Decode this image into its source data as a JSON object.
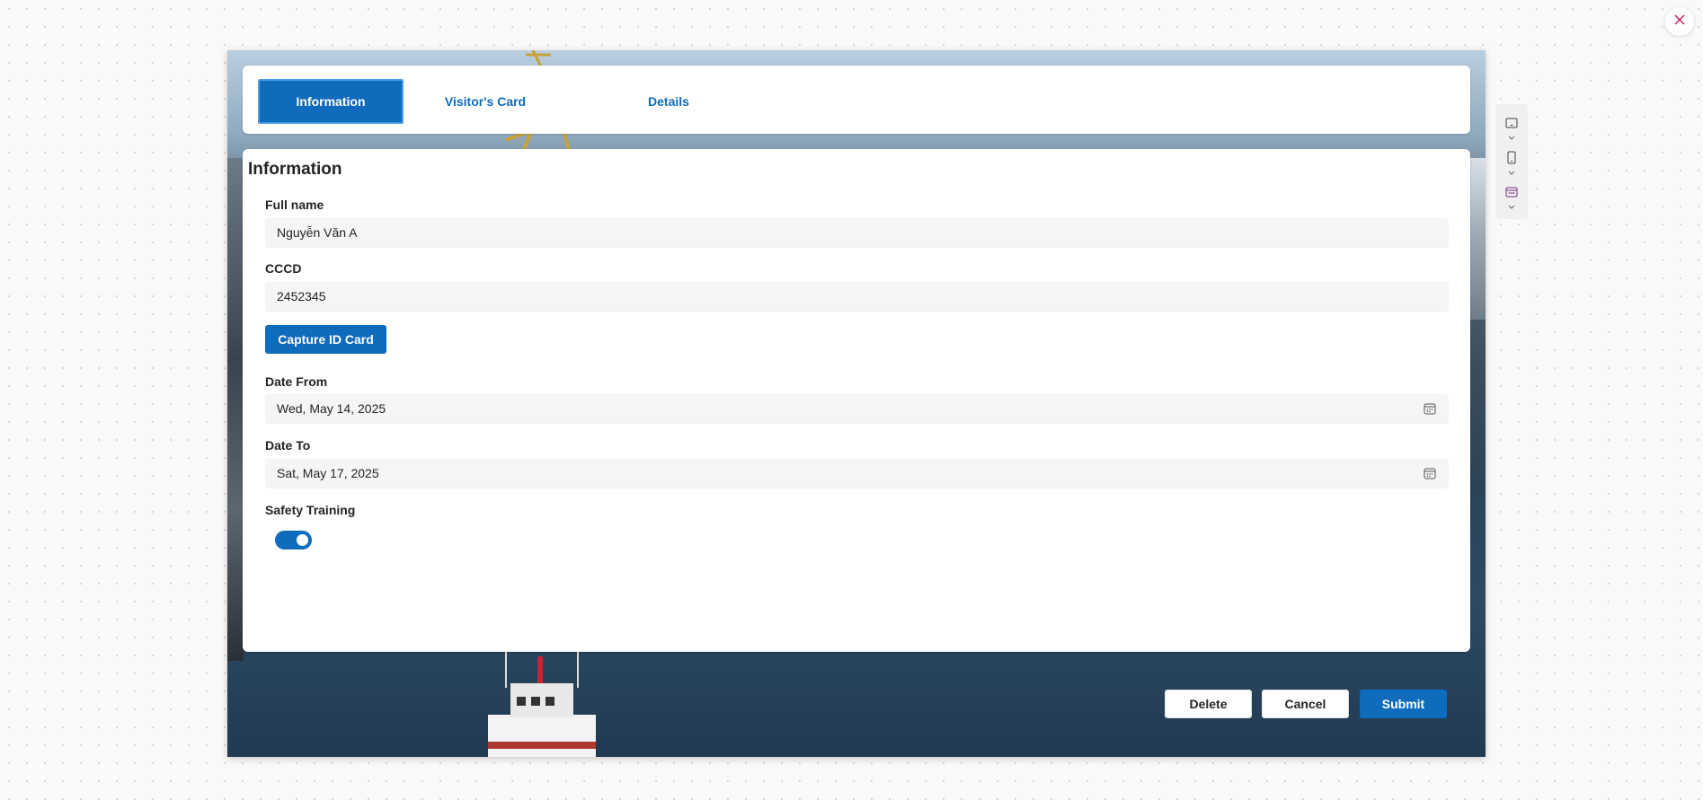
{
  "tabs": [
    {
      "label": "Information",
      "active": true
    },
    {
      "label": "Visitor's Card",
      "active": false
    },
    {
      "label": "Details",
      "active": false
    }
  ],
  "form": {
    "title": "Information",
    "full_name": {
      "label": "Full name",
      "value": "Nguyễn Văn A"
    },
    "cccd": {
      "label": "CCCD",
      "value": "2452345"
    },
    "capture_button": "Capture ID Card",
    "date_from": {
      "label": "Date From",
      "value": "Wed, May 14, 2025"
    },
    "date_to": {
      "label": "Date To",
      "value": "Sat, May 17, 2025"
    },
    "safety_training": {
      "label": "Safety Training",
      "on": true
    }
  },
  "actions": {
    "delete": "Delete",
    "cancel": "Cancel",
    "submit": "Submit"
  },
  "icons": {
    "close": "close-icon",
    "calendar": "calendar-icon",
    "tablet": "tablet-layout-icon",
    "phone": "phone-layout-icon",
    "form": "form-layout-icon"
  },
  "colors": {
    "accent": "#0f6cbd",
    "close": "#c2185b",
    "form_icon": "#7a2d8c"
  }
}
